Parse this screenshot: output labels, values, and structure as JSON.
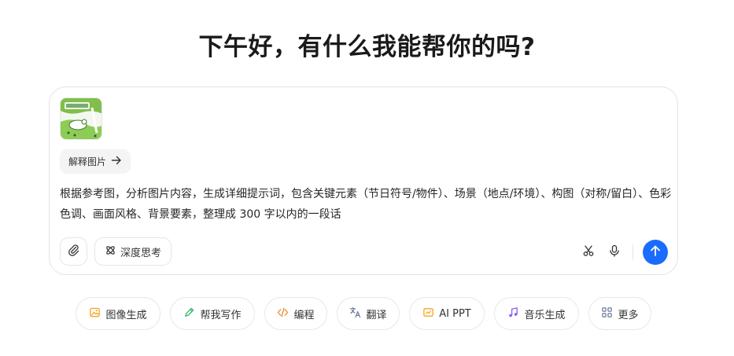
{
  "greeting": "下午好，有什么我能帮你的吗?",
  "composer": {
    "attachment": {
      "thumbnail_icon": "uploaded-image-thumbnail"
    },
    "explain_chip_label": "解释图片",
    "prompt": "根据参考图，分析图片内容，生成详细提示词，包含关键元素（节日符号/物件）、场景（地点/环境）、构图（对称/留白）、色彩色调、画面风格、背景要素，整理成 300 字以内的一段话",
    "deep_think_label": "深度思考",
    "accent_color": "#1a6cff"
  },
  "quick_actions": [
    {
      "label": "图像生成",
      "icon": "image-generate-icon",
      "color": "#f5a623"
    },
    {
      "label": "帮我写作",
      "icon": "pen-write-icon",
      "color": "#34b36b"
    },
    {
      "label": "编程",
      "icon": "code-icon",
      "color": "#f08c2e"
    },
    {
      "label": "翻译",
      "icon": "translate-icon",
      "color": "#6b7a99"
    },
    {
      "label": "AI PPT",
      "icon": "ppt-icon",
      "color": "#f5a623"
    },
    {
      "label": "音乐生成",
      "icon": "music-icon",
      "color": "#8a5cf6"
    },
    {
      "label": "更多",
      "icon": "more-grid-icon",
      "color": "#6b7a99"
    }
  ]
}
